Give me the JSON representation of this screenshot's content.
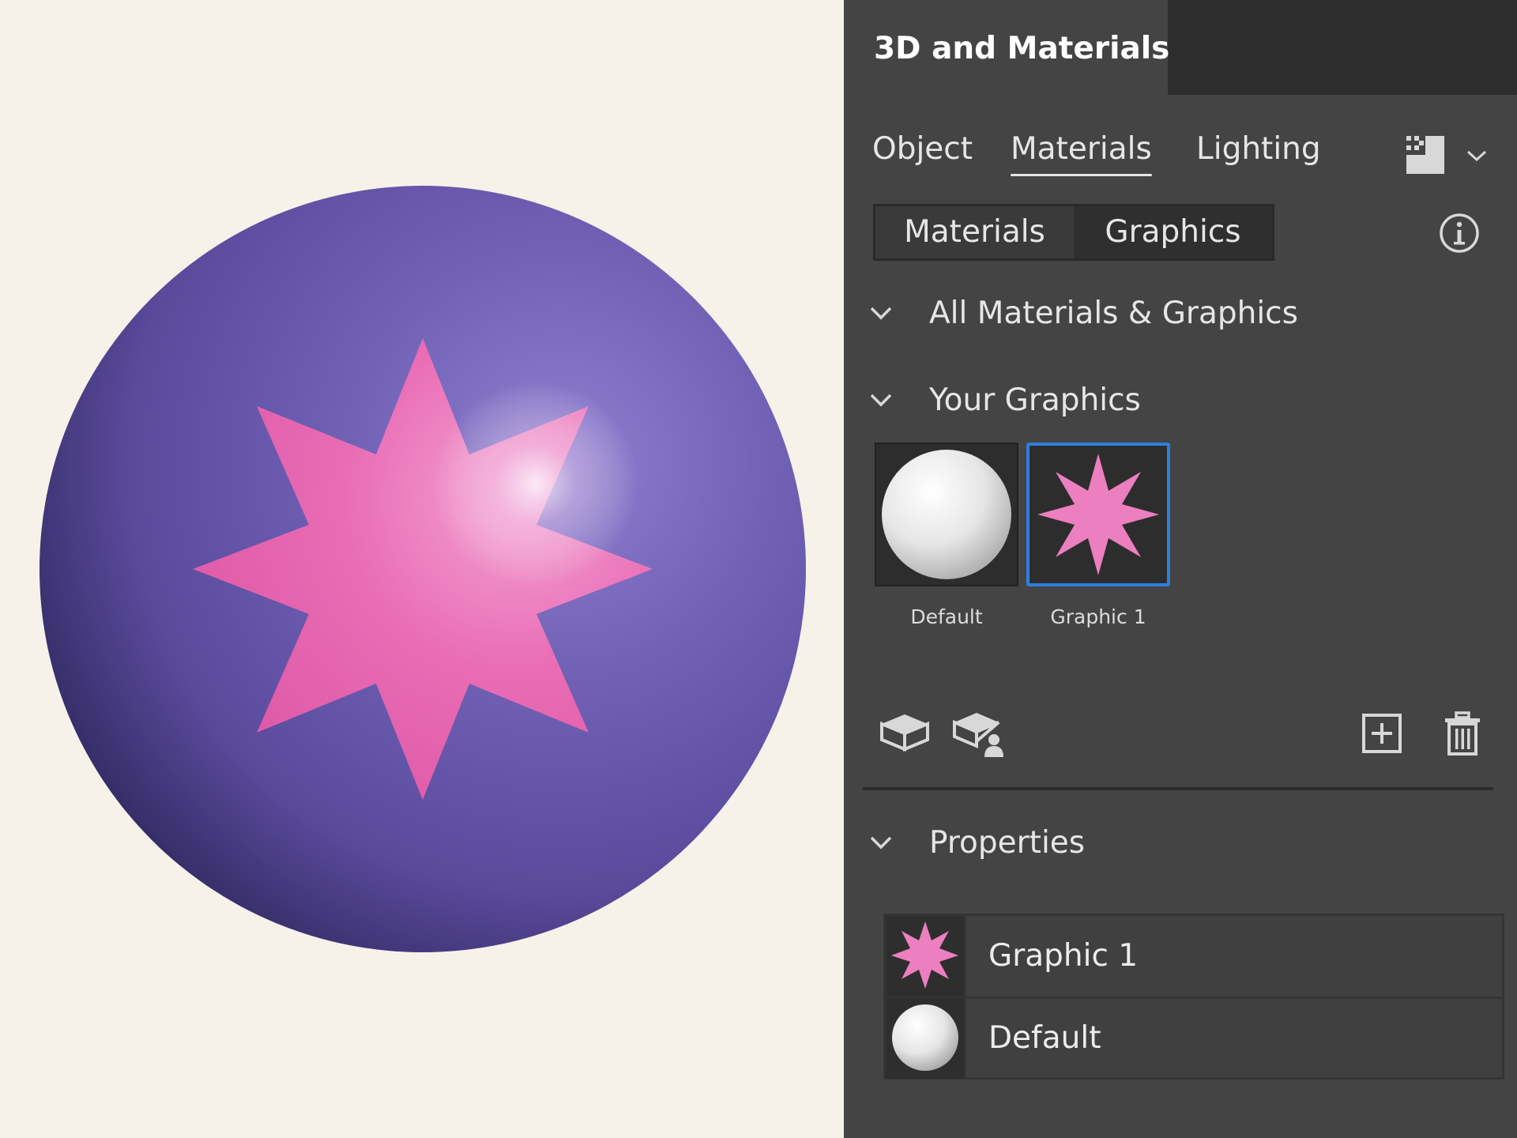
{
  "panel": {
    "title": "3D and Materials",
    "tabs": [
      {
        "label": "Object"
      },
      {
        "label": "Materials"
      },
      {
        "label": "Lighting"
      }
    ],
    "active_tab": "Materials",
    "segmented": [
      {
        "label": "Materials"
      },
      {
        "label": "Graphics"
      }
    ],
    "selected_segment": "Graphics",
    "sections": {
      "all": "All Materials & Graphics",
      "yours": "Your Graphics",
      "properties": "Properties"
    },
    "graphics": [
      {
        "label": "Default",
        "icon": "white-sphere-icon"
      },
      {
        "label": "Graphic 1",
        "icon": "pink-star-icon",
        "selected": true
      }
    ],
    "properties_list": [
      {
        "label": "Graphic 1",
        "icon": "pink-star-icon"
      },
      {
        "label": "Default",
        "icon": "white-sphere-icon"
      }
    ]
  },
  "colors": {
    "sphere": "#6b58ad",
    "star": "#e964ad",
    "selection": "#2d7fe0",
    "panel_bg": "#444444",
    "canvas_bg": "#f6f2ea"
  }
}
